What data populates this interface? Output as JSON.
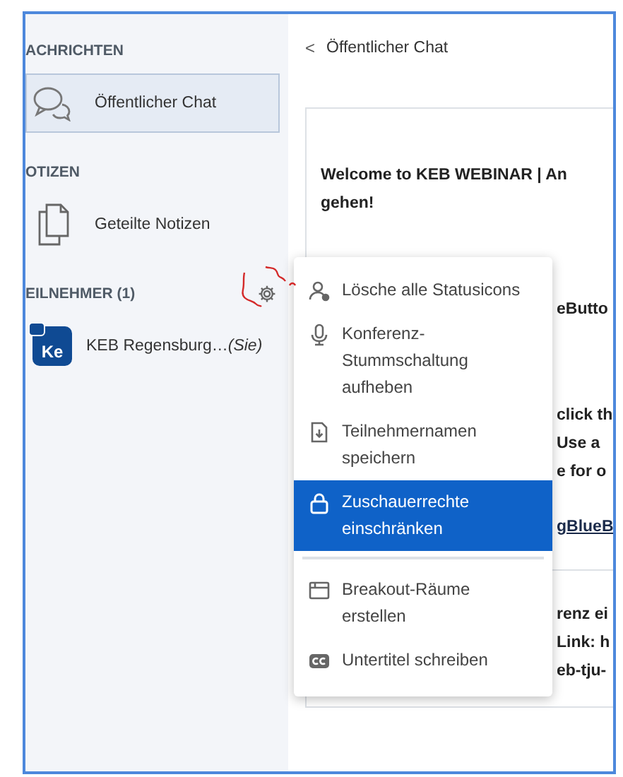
{
  "sidebar": {
    "sections": [
      {
        "heading": "ACHRICHTEN",
        "items": [
          {
            "kind": "chat",
            "label": "Öffentlicher Chat",
            "selected": true
          }
        ]
      },
      {
        "heading": "OTIZEN",
        "items": [
          {
            "kind": "notes",
            "label": "Geteilte Notizen",
            "selected": false
          }
        ]
      },
      {
        "heading": "EILNEHMER (1)",
        "gear": true,
        "items": [
          {
            "kind": "user",
            "avatar_text": "Ke",
            "label": "KEB Regensburg…",
            "suffix": "(Sie)",
            "selected": false
          }
        ]
      }
    ]
  },
  "chat": {
    "back": "<",
    "title": "Öffentlicher Chat",
    "paragraphs": [
      [
        {
          "text": "Welcome to KEB WEBINAR | An",
          "kind": "text"
        },
        {
          "text": "gehen!",
          "kind": "text"
        }
      ],
      [
        {
          "text": "eButto",
          "kind": "text"
        }
      ],
      [
        {
          "text": "click th",
          "kind": "text"
        },
        {
          "text": "Use a",
          "kind": "text"
        },
        {
          "text": "e for o",
          "kind": "text"
        }
      ],
      [
        {
          "text": "gBlueB",
          "kind": "link"
        }
      ],
      [
        {
          "text": "renz ei",
          "kind": "text"
        },
        {
          "text": "Link: h",
          "kind": "text"
        },
        {
          "text": "eb-tju-",
          "kind": "text"
        }
      ]
    ]
  },
  "menu": {
    "groups": [
      [
        {
          "kind": "person",
          "label": "Lösche alle Statusicons",
          "selected": false
        },
        {
          "kind": "mic",
          "label": "Konferenz-\nStummschaltung\naufheben",
          "selected": false
        },
        {
          "kind": "download",
          "label": "Teilnehmernamen\nspeichern",
          "selected": false
        },
        {
          "kind": "lock",
          "label": "Zuschauerrechte\neinschränken",
          "selected": true
        }
      ],
      [
        {
          "kind": "rooms",
          "label": "Breakout-Räume\nerstellen",
          "selected": false
        },
        {
          "kind": "cc",
          "label": "Untertitel schreiben",
          "selected": false
        }
      ]
    ]
  }
}
